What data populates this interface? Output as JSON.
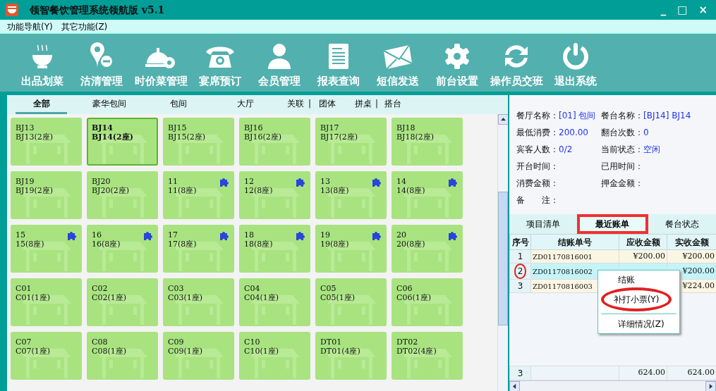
{
  "window": {
    "title": "领智餐饮管理系统领航版  v5.1",
    "controls": [
      "_",
      "□",
      "×"
    ]
  },
  "menu": [
    "功能导航(Y)",
    "其它功能(Z)"
  ],
  "toolbar": [
    {
      "kind": "bowl",
      "label": "出品划菜"
    },
    {
      "kind": "tag",
      "label": "沽清管理"
    },
    {
      "kind": "bell",
      "label": "时价菜管理"
    },
    {
      "kind": "phone",
      "label": "宴席预订"
    },
    {
      "kind": "person",
      "label": "会员管理"
    },
    {
      "kind": "document",
      "label": "报表查询"
    },
    {
      "kind": "envelope",
      "label": "短信发送"
    },
    {
      "kind": "gear",
      "label": "前台设置"
    },
    {
      "kind": "refresh",
      "label": "操作员交班"
    },
    {
      "kind": "power",
      "label": "退出系统"
    }
  ],
  "categories": [
    {
      "kind": "tab",
      "label": "全部",
      "selected": true
    },
    {
      "kind": "tab",
      "label": "豪华包间",
      "selected": false
    },
    {
      "kind": "tab",
      "label": "包间",
      "selected": false
    },
    {
      "kind": "tab",
      "label": "大厅",
      "selected": false
    },
    {
      "kind": "tab",
      "label": "关联",
      "selected": false
    },
    {
      "kind": "separator",
      "label": "|"
    },
    {
      "kind": "tab",
      "label": "团体",
      "selected": false
    },
    {
      "kind": "tab",
      "label": "拼桌",
      "selected": false
    },
    {
      "kind": "separator",
      "label": "|"
    },
    {
      "kind": "tab",
      "label": "搭台",
      "selected": false
    }
  ],
  "tables": [
    {
      "name": "BJ13",
      "seats": "BJ13(2座)",
      "selected": false,
      "linked": false
    },
    {
      "name": "BJ14",
      "seats": "BJ14(2座)",
      "selected": true,
      "linked": false
    },
    {
      "name": "BJ15",
      "seats": "BJ15(2座)",
      "selected": false,
      "linked": false
    },
    {
      "name": "BJ16",
      "seats": "BJ16(2座)",
      "selected": false,
      "linked": false
    },
    {
      "name": "BJ17",
      "seats": "BJ17(2座)",
      "selected": false,
      "linked": false
    },
    {
      "name": "BJ18",
      "seats": "BJ18(2座)",
      "selected": false,
      "linked": false
    },
    {
      "name": "BJ19",
      "seats": "BJ19(2座)",
      "selected": false,
      "linked": false
    },
    {
      "name": "BJ20",
      "seats": "BJ20(2座)",
      "selected": false,
      "linked": false
    },
    {
      "name": "11",
      "seats": "11(8座)",
      "selected": false,
      "linked": true
    },
    {
      "name": "12",
      "seats": "12(8座)",
      "selected": false,
      "linked": true
    },
    {
      "name": "13",
      "seats": "13(8座)",
      "selected": false,
      "linked": true
    },
    {
      "name": "14",
      "seats": "14(8座)",
      "selected": false,
      "linked": true
    },
    {
      "name": "15",
      "seats": "15(8座)",
      "selected": false,
      "linked": true
    },
    {
      "name": "16",
      "seats": "16(8座)",
      "selected": false,
      "linked": true
    },
    {
      "name": "17",
      "seats": "17(8座)",
      "selected": false,
      "linked": true
    },
    {
      "name": "18",
      "seats": "18(8座)",
      "selected": false,
      "linked": true
    },
    {
      "name": "19",
      "seats": "19(8座)",
      "selected": false,
      "linked": true
    },
    {
      "name": "20",
      "seats": "20(8座)",
      "selected": false,
      "linked": true
    },
    {
      "name": "C01",
      "seats": "C01(1座)",
      "selected": false,
      "linked": false
    },
    {
      "name": "C02",
      "seats": "C02(1座)",
      "selected": false,
      "linked": false
    },
    {
      "name": "C03",
      "seats": "C03(1座)",
      "selected": false,
      "linked": false
    },
    {
      "name": "C04",
      "seats": "C04(1座)",
      "selected": false,
      "linked": false
    },
    {
      "name": "C05",
      "seats": "C05(1座)",
      "selected": false,
      "linked": false
    },
    {
      "name": "C06",
      "seats": "C06(1座)",
      "selected": false,
      "linked": false
    },
    {
      "name": "C07",
      "seats": "C07(1座)",
      "selected": false,
      "linked": false
    },
    {
      "name": "C08",
      "seats": "C08(1座)",
      "selected": false,
      "linked": false
    },
    {
      "name": "C09",
      "seats": "C09(1座)",
      "selected": false,
      "linked": false
    },
    {
      "name": "C10",
      "seats": "C10(1座)",
      "selected": false,
      "linked": false
    },
    {
      "name": "DT01",
      "seats": "DT01(4座)",
      "selected": false,
      "linked": false
    },
    {
      "name": "DT02",
      "seats": "DT02(4座)",
      "selected": false,
      "linked": false
    }
  ],
  "details": [
    {
      "label": "餐厅名称：",
      "value": "[01] 包间"
    },
    {
      "label": "餐台名称：",
      "value": "[BJ14] BJ14"
    },
    {
      "label": "最低消费：",
      "value": "200.00"
    },
    {
      "label": "翻台次数：",
      "value": "0"
    },
    {
      "label": "宾客人数：",
      "value": "0/2"
    },
    {
      "label": "当前状态：",
      "value": "空闲"
    },
    {
      "label": "开台时间："
    },
    {
      "label": "已用时间："
    },
    {
      "label": "消费金额："
    },
    {
      "label": "押金金额："
    },
    {
      "label": "备　　注："
    }
  ],
  "detail_tabs": [
    {
      "label": "项目清单",
      "selected": false,
      "highlighted": false
    },
    {
      "label": "最近账单",
      "selected": true,
      "highlighted": true
    },
    {
      "label": "餐台状态",
      "selected": false,
      "highlighted": false
    }
  ],
  "bills": {
    "columns": [
      "序号",
      "结账单号",
      "应收金额",
      "实收金额"
    ],
    "rows": [
      {
        "no": "1",
        "bill": "ZD01170816001",
        "due": "¥200.00",
        "paid": "¥200.00",
        "selected": false,
        "circled": false
      },
      {
        "no": "2",
        "bill": "ZD01170816002",
        "paid": "¥200.00",
        "selected": true,
        "circled": true
      },
      {
        "no": "3",
        "bill": "ZD01170816003",
        "paid": "¥224.00",
        "selected": false,
        "circled": false
      }
    ],
    "footer": {
      "count": "3",
      "due": "624.00",
      "paid": "624.00"
    }
  },
  "context_menu": [
    {
      "kind": "item",
      "label": "结账",
      "circled": false
    },
    {
      "kind": "item",
      "label": "补打小票(Y)",
      "circled": true
    },
    {
      "kind": "separator"
    },
    {
      "kind": "item",
      "label": "详细情况(Z)",
      "circled": false
    }
  ]
}
